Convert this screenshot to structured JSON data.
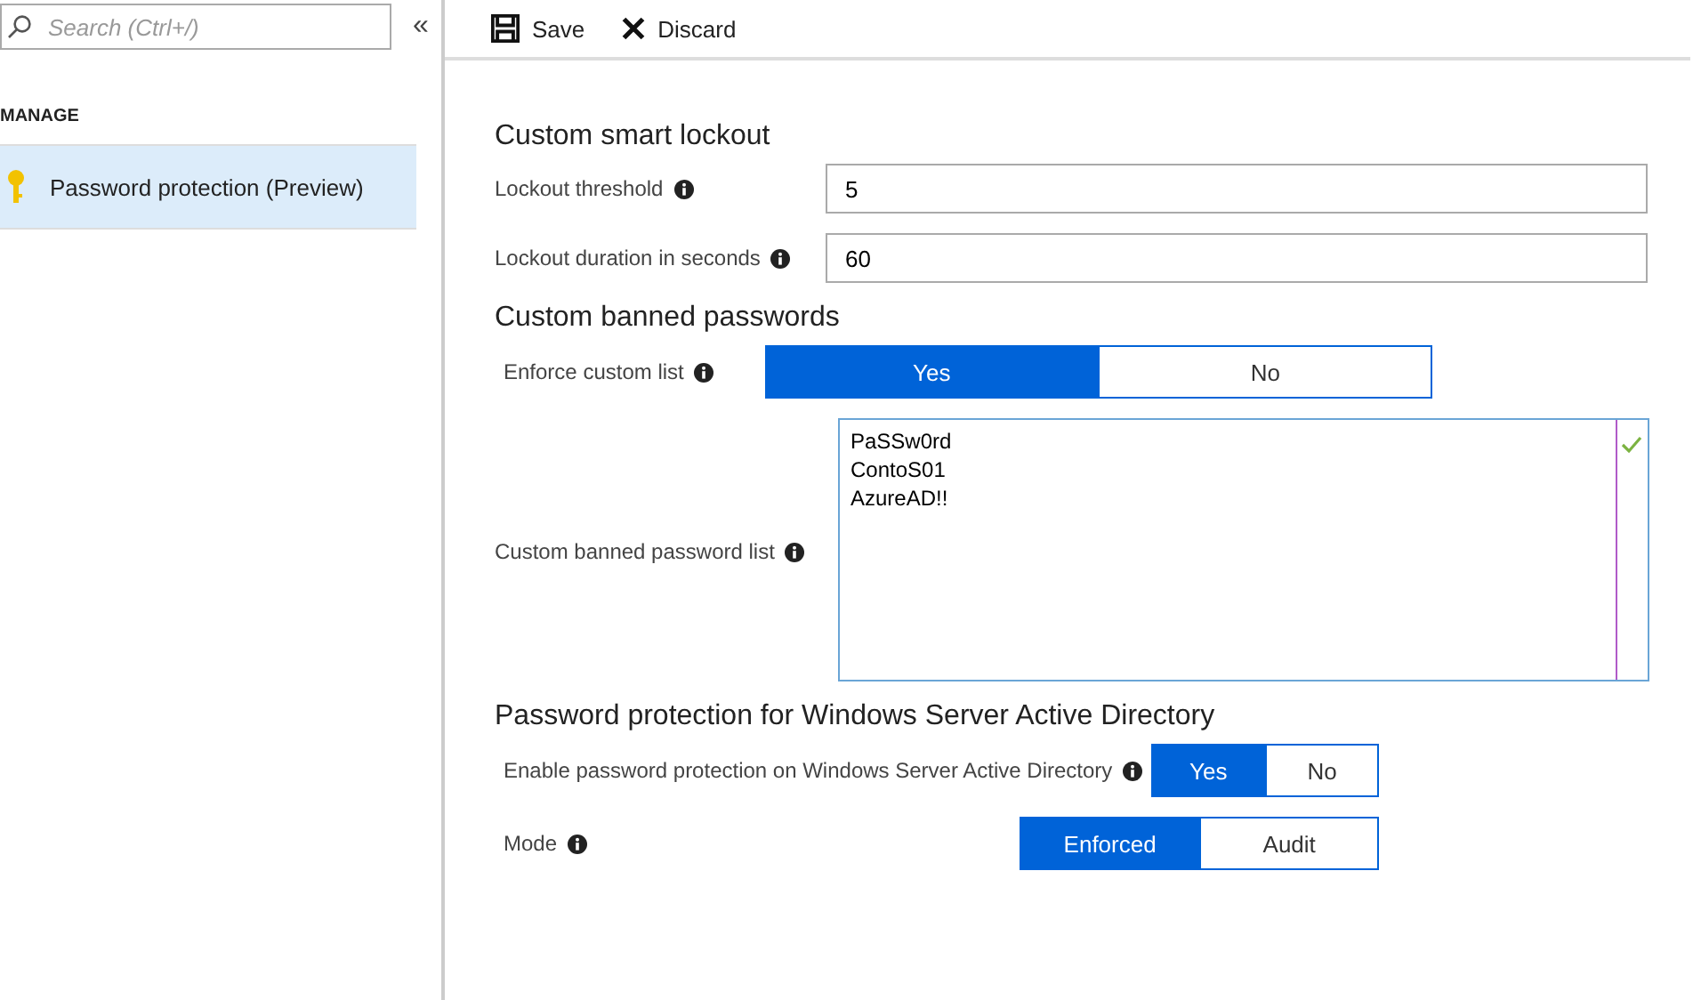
{
  "sidebar": {
    "search": {
      "placeholder": "Search (Ctrl+/)"
    },
    "collapse": "«",
    "section": "MANAGE",
    "items": [
      {
        "label": "Password protection (Preview)",
        "selected": true
      }
    ]
  },
  "toolbar": [
    {
      "kind": "save",
      "label": "Save"
    },
    {
      "kind": "discard",
      "label": "Discard"
    }
  ],
  "sections": [
    {
      "title": "Custom smart lockout",
      "rows": [
        {
          "kind": "input",
          "label": "Lockout threshold",
          "value": "5"
        },
        {
          "kind": "input",
          "label": "Lockout duration in seconds",
          "value": "60"
        }
      ]
    },
    {
      "title": "Custom banned passwords",
      "rows": [
        {
          "kind": "toggle",
          "label": "Enforce custom list",
          "options": [
            {
              "label": "Yes",
              "selected": true
            },
            {
              "label": "No",
              "selected": false
            }
          ]
        },
        {
          "kind": "list",
          "label": "Custom banned password list",
          "lines": [
            "PaSSw0rd",
            "ContoS01",
            "AzureAD!!"
          ],
          "valid": true
        }
      ]
    },
    {
      "title": "Password protection for Windows Server Active Directory",
      "rows": [
        {
          "kind": "toggle",
          "label": "Enable password protection on Windows Server Active Directory",
          "options": [
            {
              "label": "Yes",
              "selected": true
            },
            {
              "label": "No",
              "selected": false
            }
          ]
        },
        {
          "kind": "toggle",
          "label": "Mode",
          "options": [
            {
              "label": "Enforced",
              "selected": true
            },
            {
              "label": "Audit",
              "selected": false
            }
          ]
        }
      ]
    }
  ]
}
